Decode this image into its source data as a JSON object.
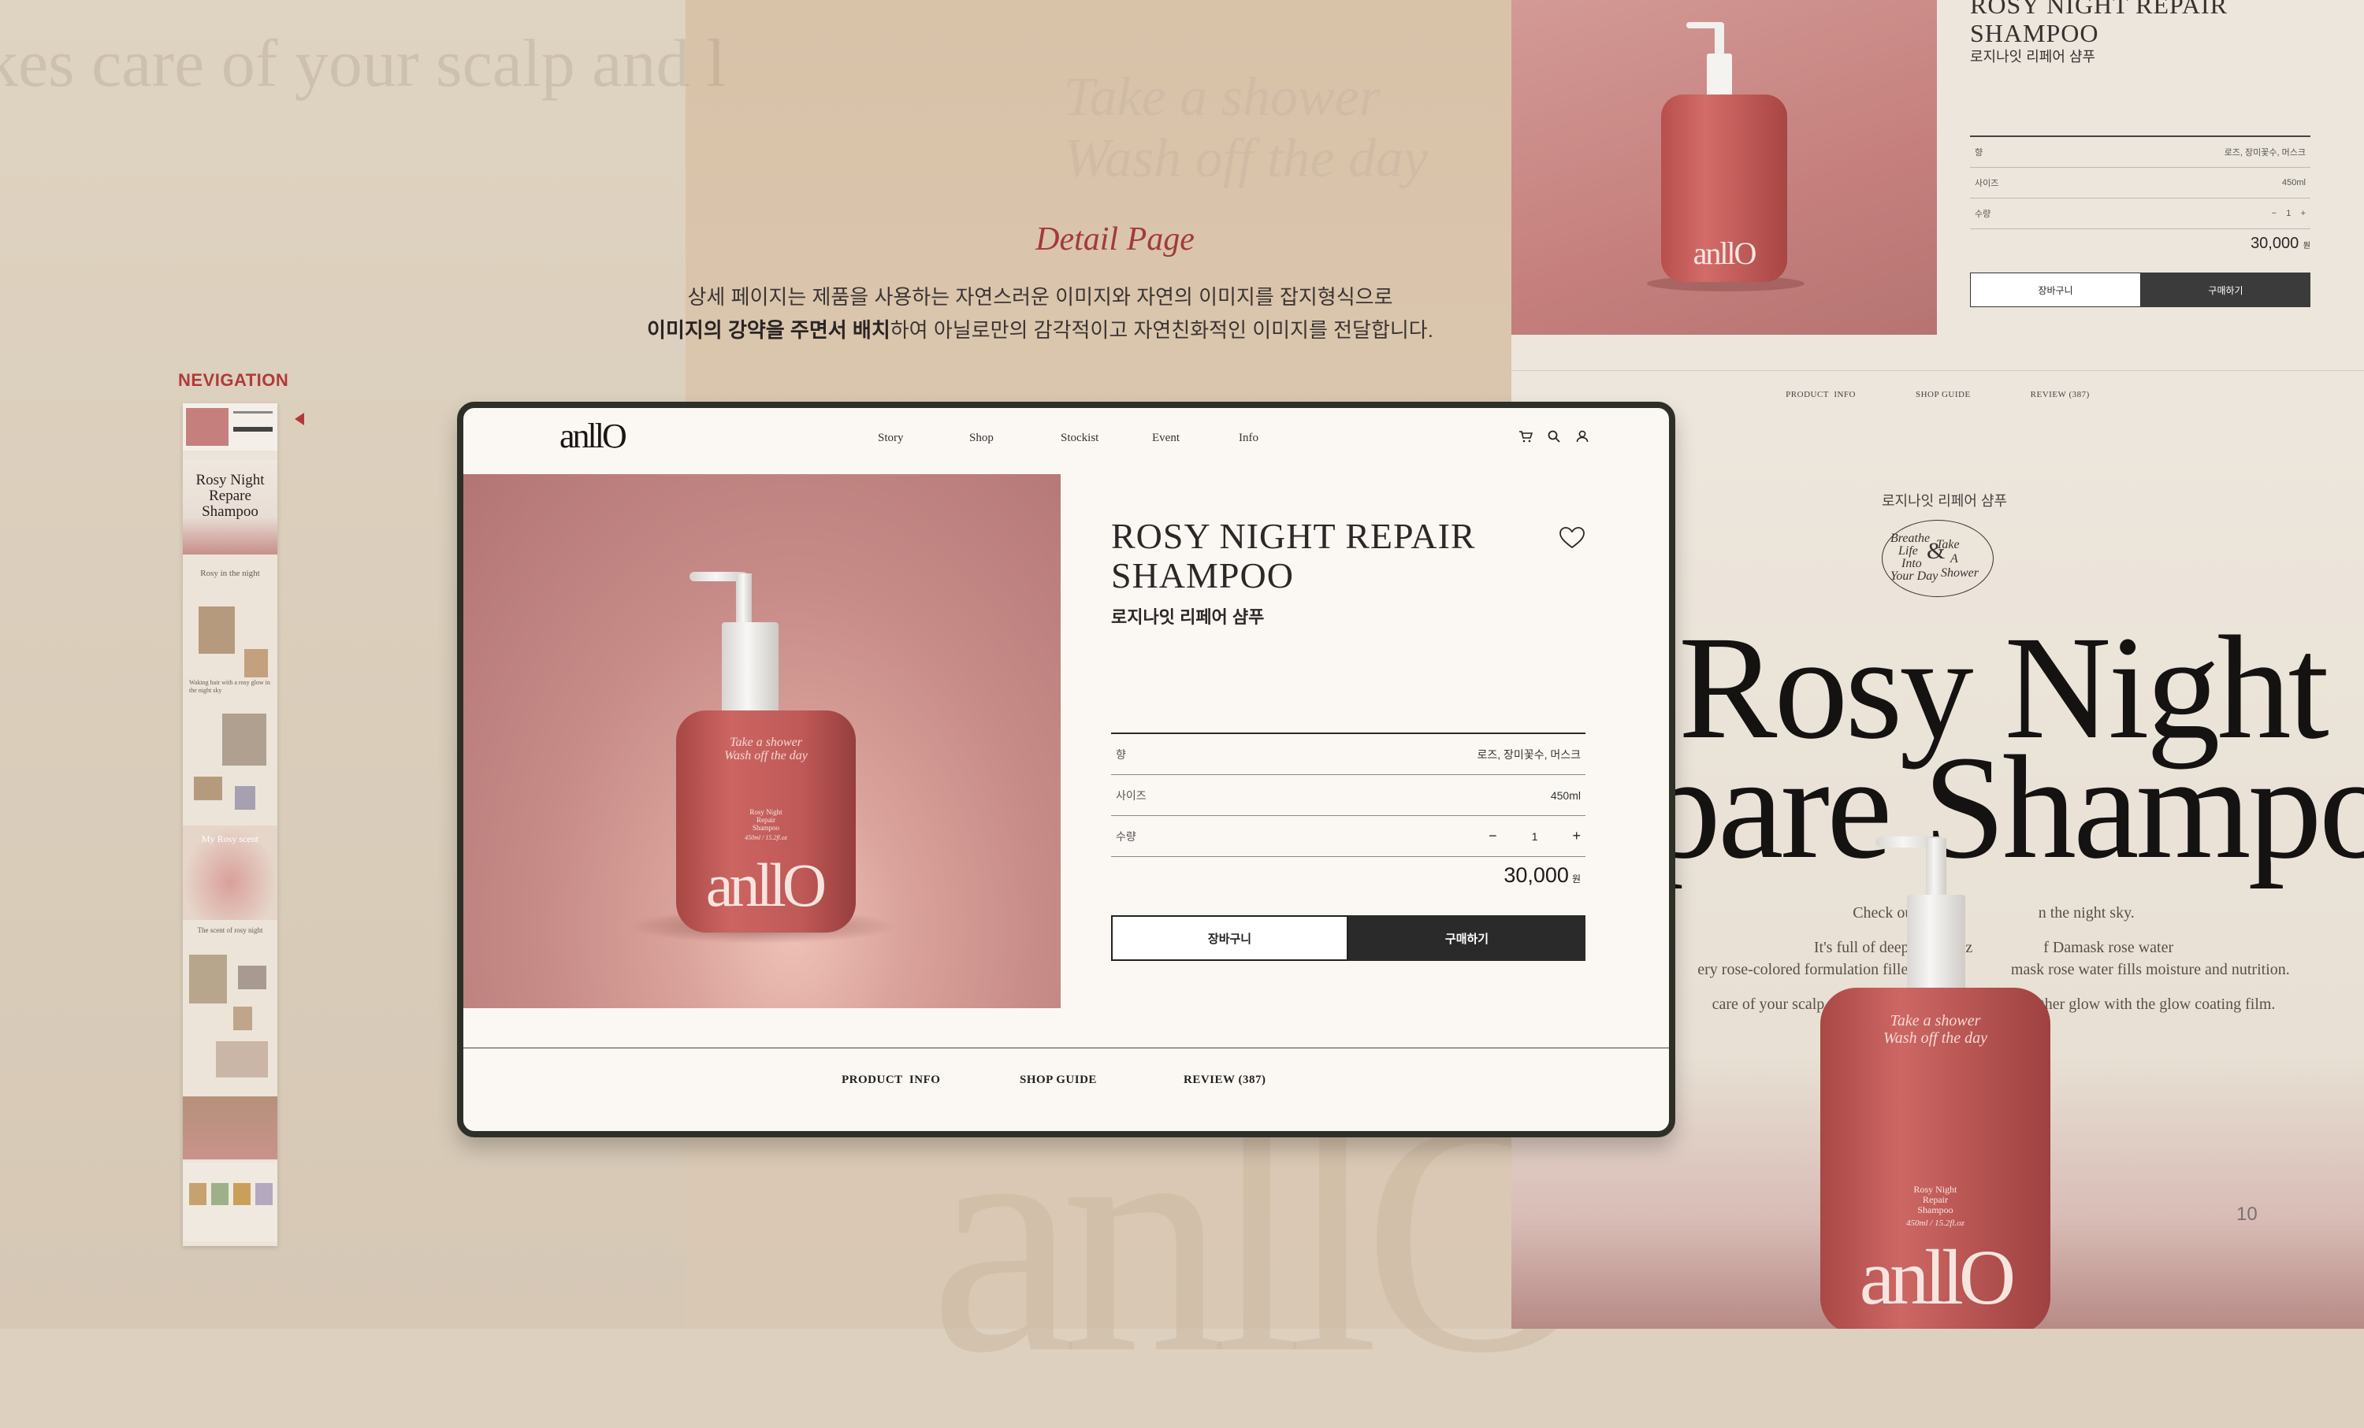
{
  "background": {
    "ghost_headline": "kes care of your scalp and l",
    "ghost_slogan": [
      "Take a shower",
      "Wash off the day"
    ],
    "ghost_logo": "anllO"
  },
  "section": {
    "title": "Detail Page",
    "desc_line1": "상세 페이지는 제품을 사용하는 자연스러운 이미지와 자연의 이미지를 잡지형식으로",
    "desc_line2_bold": "이미지의 강약을 주면서 배치",
    "desc_line2_rest": "하여 아닐로만의 감각적이고 자연친화적인 이미지를 전달합니다."
  },
  "navigation": {
    "label": "NEVIGATION",
    "thumb_texts": [
      "Rosy Night Repare Shampoo",
      "Rosy in the night",
      "Waking hair with a rosy glow in the night sky",
      "My Rosy scent",
      "The scent of rosy night"
    ]
  },
  "card": {
    "logo": "anllO",
    "nav": [
      "Story",
      "Shop",
      "Stockist",
      "Event",
      "Info"
    ],
    "icons": [
      "cart-icon",
      "search-icon",
      "user-icon"
    ],
    "product": {
      "title_line1": "ROSY NIGHT REPAIR",
      "title_line2": "SHAMPOO",
      "name_kor": "로지나잇 리페어 샴푸",
      "specs": [
        {
          "label": "향",
          "value": "로즈, 장미꽃수, 머스크"
        },
        {
          "label": "사이즈",
          "value": "450ml"
        },
        {
          "label": "수량",
          "minus": "−",
          "qty": "1",
          "plus": "+"
        }
      ],
      "price": "30,000",
      "currency": "원",
      "cart_label": "장바구니",
      "buy_label": "구매하기"
    },
    "tabs": [
      "PRODUCT  INFO",
      "SHOP GUIDE",
      "REVIEW (387)"
    ],
    "bottle": {
      "slogan1": "Take a shower",
      "slogan2": "Wash off the day",
      "label1": "Rosy Night",
      "label2": "Repair",
      "label3": "Shampoo",
      "volume": "450ml / 15.2fl.oz",
      "logo": "anllO"
    }
  },
  "right_panel": {
    "title_line1": "ROSY NIGHT REPAIR",
    "title_line2": "SHAMPOO",
    "name_kor": "로지나잇 리페어 샴푸",
    "specs": [
      {
        "label": "향",
        "value": "로즈, 장미꽃수, 머스크"
      },
      {
        "label": "사이즈",
        "value": "450ml"
      },
      {
        "label": "수량",
        "value": "−    1    +"
      }
    ],
    "price": "30,000",
    "currency": "원",
    "cart_label": "장바구니",
    "buy_label": "구매하기",
    "tabs": [
      "PRODUCT  INFO",
      "SHOP GUIDE",
      "REVIEW (387)"
    ],
    "lower_kor": "로지나잇 리페어 샴푸",
    "badge": [
      "Breathe",
      "Life",
      "Into",
      "Your Day",
      "Take",
      "A",
      "Shower"
    ],
    "big_line1": "Rosy Night",
    "big_line2": "pare Shampoo",
    "copy1": "Check out the ros                   n the night sky.",
    "copy2": "It's full of deep moisturiz                  f Damask rose water",
    "copy3": "ery rose-colored formulation filled wit                  mask rose water fills moisture and nutrition.",
    "copy4": "care of your scalp and                                            oother glow with the glow coating film.",
    "page_number": "10"
  },
  "colors": {
    "accent": "#b03a3a",
    "frame": "#2e3027",
    "bottle": "#c25a58",
    "card_bg": "#fbf8f3"
  }
}
